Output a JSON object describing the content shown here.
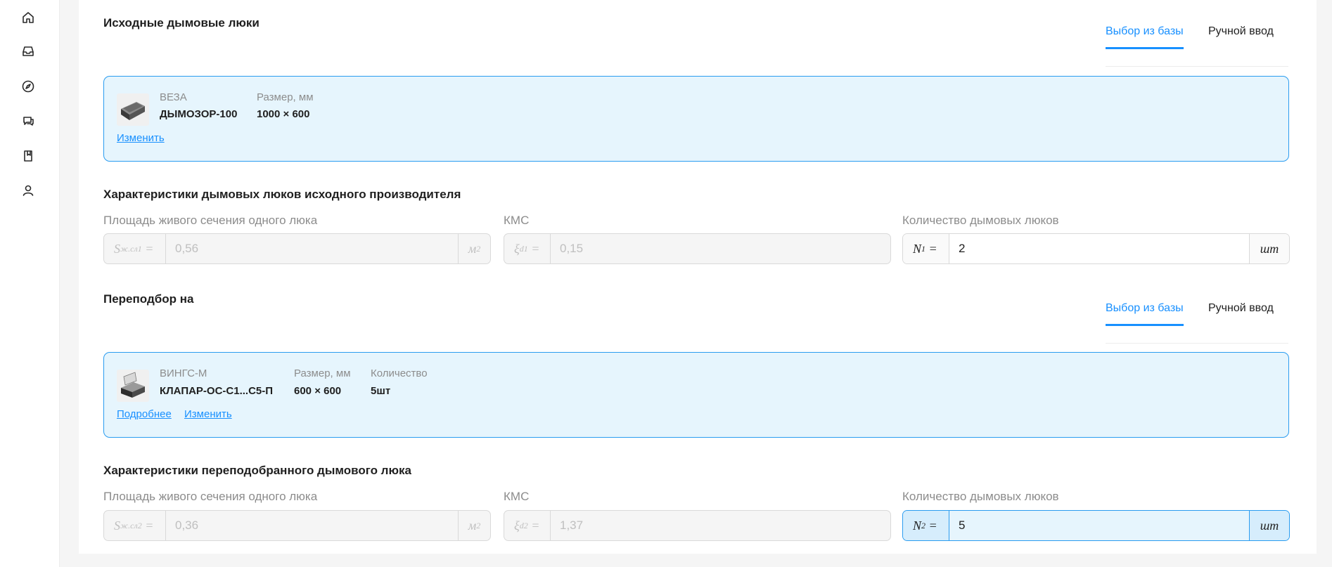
{
  "sidebar": {
    "items": [
      {
        "icon": "home-icon"
      },
      {
        "icon": "inbox-icon"
      },
      {
        "icon": "compass-icon"
      },
      {
        "icon": "chat-icon"
      },
      {
        "icon": "book-icon"
      },
      {
        "icon": "user-icon"
      }
    ]
  },
  "source": {
    "title": "Исходные дымовые люки",
    "tabs": [
      "Выбор из базы",
      "Ручной ввод"
    ],
    "active_tab": "Выбор из базы",
    "product": {
      "manufacturer": "ВЕЗА",
      "model": "ДЫМОЗОР-100",
      "size_label": "Размер, мм",
      "size_value": "1000 × 600",
      "change_link": "Изменить"
    },
    "characteristics_title": "Характеристики дымовых люков исходного производителя",
    "area_label": "Площадь живого сечения одного люка",
    "area_prefix_symbol": "S",
    "area_prefix_sub": "ж.сл1",
    "area_value": "0,56",
    "area_unit": "м",
    "area_unit_sup": "2",
    "kms_label": "КМС",
    "kms_prefix_symbol": "ξ",
    "kms_prefix_sub": "d1",
    "kms_value": "0,15",
    "count_label": "Количество дымовых люков",
    "count_prefix_symbol": "N",
    "count_prefix_sub": "1",
    "count_value": "2",
    "count_unit": "шт"
  },
  "replacement": {
    "title": "Переподбор на",
    "tabs": [
      "Выбор из базы",
      "Ручной ввод"
    ],
    "active_tab": "Выбор из базы",
    "product": {
      "manufacturer": "ВИНГС-М",
      "model": "КЛАПАР-ОС-С1...С5-П",
      "size_label": "Размер, мм",
      "size_value": "600 × 600",
      "quantity_label": "Количество",
      "quantity_value": "5шт",
      "details_link": "Подробнее",
      "change_link": "Изменить"
    },
    "characteristics_title": "Характеристики переподобранного дымового люка",
    "area_label": "Площадь живого сечения одного люка",
    "area_prefix_symbol": "S",
    "area_prefix_sub": "ж.сл2",
    "area_value": "0,36",
    "area_unit": "м",
    "area_unit_sup": "2",
    "kms_label": "КМС",
    "kms_prefix_symbol": "ξ",
    "kms_prefix_sub": "d2",
    "kms_value": "1,37",
    "count_label": "Количество дымовых люков",
    "count_prefix_symbol": "N",
    "count_prefix_sub": "2",
    "count_value": "5",
    "count_unit": "шт"
  },
  "colors": {
    "accent": "#1890ff",
    "card_bg": "#e6f5fd",
    "card_border": "#2a9cf0"
  }
}
